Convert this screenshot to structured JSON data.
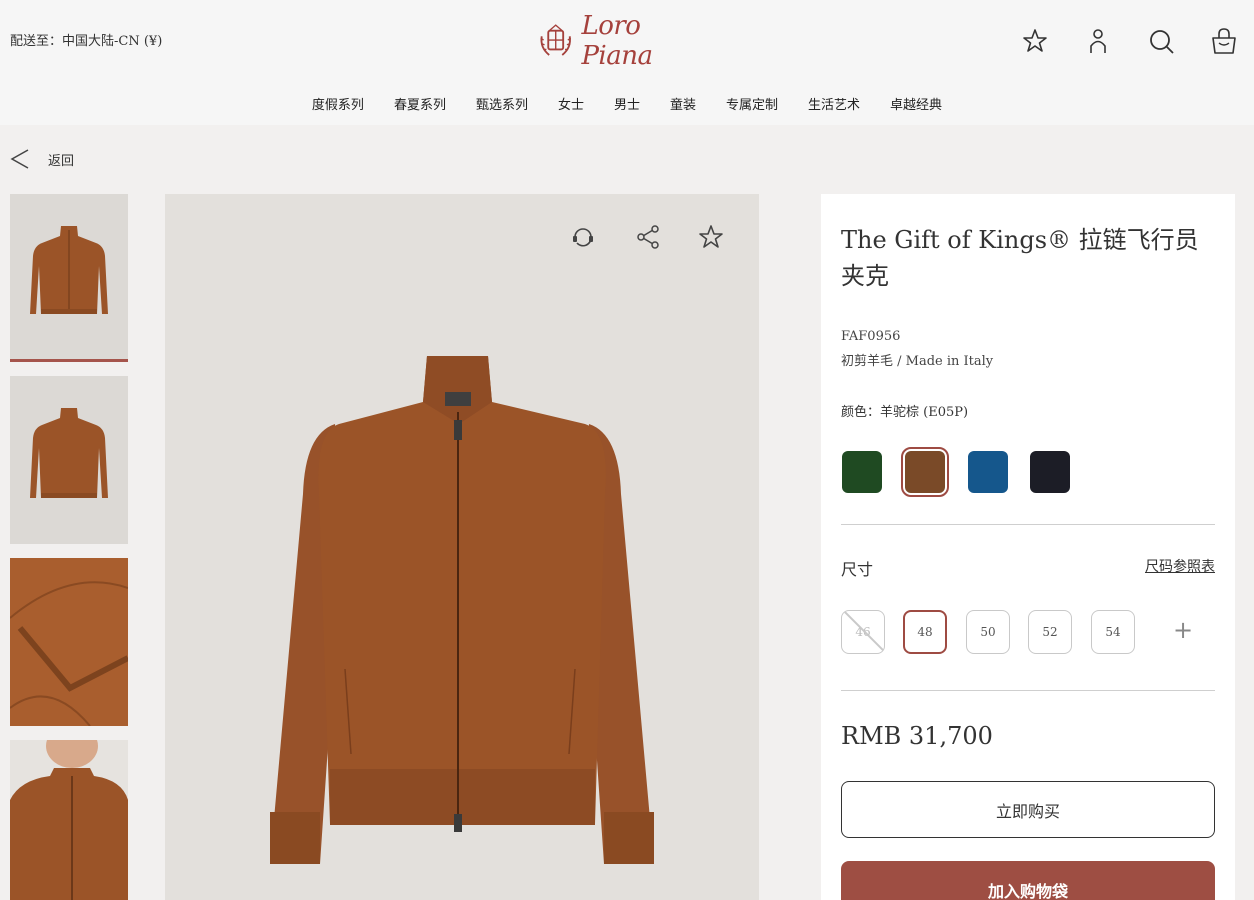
{
  "header": {
    "ship_to": "配送至：中国大陆-CN (¥)",
    "brand": "Loro Piana",
    "icons": [
      "star-icon",
      "user-icon",
      "search-icon",
      "bag-icon"
    ],
    "brand_color": "#a5413c"
  },
  "nav": {
    "items": [
      "度假系列",
      "春夏系列",
      "甄选系列",
      "女士",
      "男士",
      "童装",
      "专属定制",
      "生活艺术",
      "卓越经典"
    ]
  },
  "back_label": "返回",
  "image_actions": [
    "refresh-icon",
    "share-icon",
    "star-icon"
  ],
  "product": {
    "title": "The Gift of Kings® 拉链飞行员夹克",
    "sku": "FAF0956",
    "material": "初剪羊毛 / Made in Italy",
    "color_line": "颜色：羊驼棕 (E05P)",
    "swatches": [
      {
        "name": "green",
        "color": "#1f4a22"
      },
      {
        "name": "brown",
        "color": "#7a4a28",
        "selected": true
      },
      {
        "name": "blue",
        "color": "#15578c"
      },
      {
        "name": "navy",
        "color": "#1c1d26"
      }
    ],
    "size_label": "尺寸",
    "size_guide": "尺码参照表",
    "sizes": [
      {
        "label": "46",
        "available": false
      },
      {
        "label": "48",
        "selected": true
      },
      {
        "label": "50"
      },
      {
        "label": "52"
      },
      {
        "label": "54"
      }
    ],
    "more_sizes": "+",
    "price": "RMB 31,700",
    "buy_now": "立即购买",
    "add_to_bag": "加入购物袋",
    "garment_color": "#9b5428",
    "accent_color": "#9e4e43"
  }
}
